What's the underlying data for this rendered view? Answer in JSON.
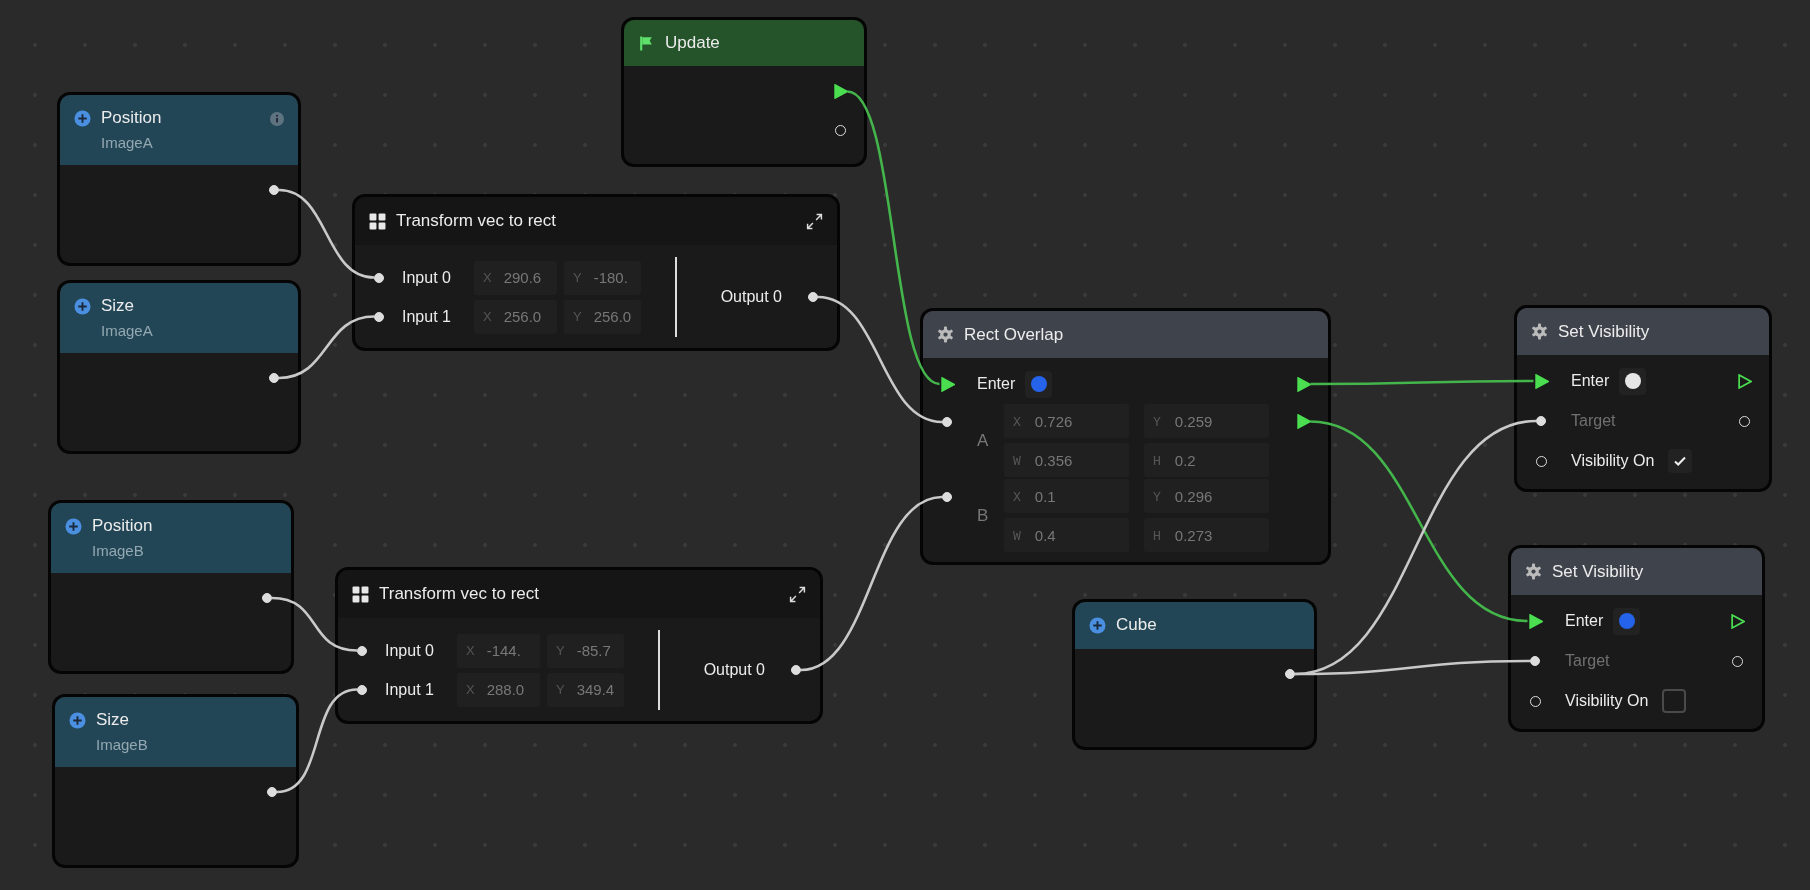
{
  "nodes": [
    {
      "kind": "variable",
      "title": "Position",
      "subtitle": "ImageA",
      "info": true,
      "out": {
        "connected": true
      }
    },
    {
      "kind": "variable",
      "title": "Size",
      "subtitle": "ImageA",
      "info": false,
      "out": {
        "connected": true
      }
    },
    {
      "kind": "event",
      "title": "Update",
      "outputs": [
        {
          "kind": "exec",
          "connected": true
        },
        {
          "kind": "data",
          "connected": false
        }
      ]
    },
    {
      "kind": "function",
      "title": "Transform vec to rect",
      "inputs": [
        {
          "label": "Input 0",
          "connected": true,
          "fields": [
            {
              "axis": "X",
              "value": "290.6"
            },
            {
              "axis": "Y",
              "value": "-180."
            }
          ]
        },
        {
          "label": "Input 1",
          "connected": true,
          "fields": [
            {
              "axis": "X",
              "value": "256.0"
            },
            {
              "axis": "Y",
              "value": "256.0"
            }
          ]
        }
      ],
      "outputs": [
        {
          "label": "Output 0",
          "connected": true
        }
      ]
    },
    {
      "kind": "variable",
      "title": "Position",
      "subtitle": "ImageB",
      "info": false,
      "out": {
        "connected": true
      }
    },
    {
      "kind": "variable",
      "title": "Size",
      "subtitle": "ImageB",
      "info": false,
      "out": {
        "connected": true
      }
    },
    {
      "kind": "function",
      "title": "Transform vec to rect",
      "inputs": [
        {
          "label": "Input 0",
          "connected": true,
          "fields": [
            {
              "axis": "X",
              "value": "-144."
            },
            {
              "axis": "Y",
              "value": "-85.7"
            }
          ]
        },
        {
          "label": "Input 1",
          "connected": true,
          "fields": [
            {
              "axis": "X",
              "value": "288.0"
            },
            {
              "axis": "Y",
              "value": "349.4"
            }
          ]
        }
      ],
      "outputs": [
        {
          "label": "Output 0",
          "connected": true
        }
      ]
    },
    {
      "kind": "action",
      "title": "Rect Overlap",
      "rows": [
        {
          "kind": "exec",
          "label": "Enter",
          "in": {
            "connected": true
          },
          "out": {
            "connected": true
          },
          "color": "#2563eb"
        },
        {
          "kind": "rect",
          "label": "A",
          "in": {
            "connected": true
          },
          "out": {
            "connected": true
          },
          "fields": [
            {
              "axis": "X",
              "value": "0.726"
            },
            {
              "axis": "Y",
              "value": "0.259"
            },
            {
              "axis": "W",
              "value": "0.356"
            },
            {
              "axis": "H",
              "value": "0.2"
            }
          ]
        },
        {
          "kind": "rect",
          "label": "B",
          "in": {
            "connected": true
          },
          "fields": [
            {
              "axis": "X",
              "value": "0.1"
            },
            {
              "axis": "Y",
              "value": "0.296"
            },
            {
              "axis": "W",
              "value": "0.4"
            },
            {
              "axis": "H",
              "value": "0.273"
            }
          ]
        }
      ]
    },
    {
      "kind": "variable",
      "title": "Cube",
      "info": false,
      "out": {
        "connected": true
      }
    },
    {
      "kind": "action",
      "title": "Set Visibility",
      "rows": [
        {
          "kind": "exec",
          "label": "Enter",
          "in": {
            "connected": true
          },
          "out": {
            "connected": false
          },
          "color": "#e6e6e6"
        },
        {
          "kind": "data",
          "label": "Target",
          "disabled": true,
          "in": {
            "connected": true
          },
          "out": {
            "connected": false
          }
        },
        {
          "kind": "bool",
          "label": "Visibility On",
          "disabled": false,
          "in": {
            "connected": false
          },
          "checked": true
        }
      ]
    },
    {
      "kind": "action",
      "title": "Set Visibility",
      "rows": [
        {
          "kind": "exec",
          "label": "Enter",
          "in": {
            "connected": true
          },
          "out": {
            "connected": false
          },
          "color": "#2563eb"
        },
        {
          "kind": "data",
          "label": "Target",
          "disabled": true,
          "in": {
            "connected": true
          },
          "out": {
            "connected": false
          }
        },
        {
          "kind": "bool",
          "label": "Visibility On",
          "disabled": false,
          "in": {
            "connected": false
          },
          "checked": false
        }
      ]
    }
  ]
}
